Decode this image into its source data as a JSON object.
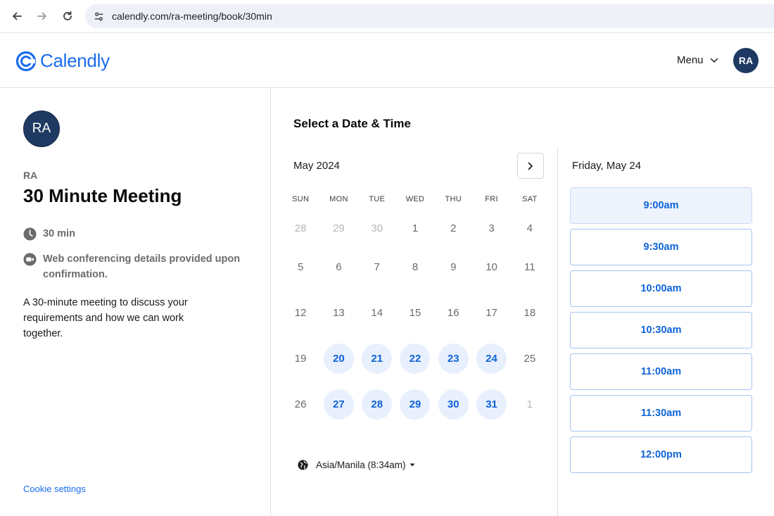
{
  "browser": {
    "url": "calendly.com/ra-meeting/book/30min",
    "icons": {
      "back": "arrow-left-icon",
      "forward": "arrow-right-icon",
      "reload": "reload-icon",
      "site_settings": "tune-icon"
    }
  },
  "header": {
    "logo_text": "Calendly",
    "menu_label": "Menu",
    "avatar_initials": "RA",
    "brand_color": "#1a6bf0",
    "avatar_color": "#1e3a62"
  },
  "event": {
    "host_initials": "RA",
    "host_name": "RA",
    "title": "30 Minute Meeting",
    "duration": "30 min",
    "conferencing_line1": "Web conferencing details provided upon",
    "conferencing_line2": "confirmation.",
    "description": "A 30-minute meeting to discuss your requirements and how we can work together.",
    "cookie_settings": "Cookie settings"
  },
  "calendar": {
    "heading": "Select a Date & Time",
    "month": "May 2024",
    "weekdays": [
      "SUN",
      "MON",
      "TUE",
      "WED",
      "THU",
      "FRI",
      "SAT"
    ],
    "weeks": [
      [
        {
          "d": "28",
          "s": "outside"
        },
        {
          "d": "29",
          "s": "outside"
        },
        {
          "d": "30",
          "s": "outside"
        },
        {
          "d": "1",
          "s": "unavailable"
        },
        {
          "d": "2",
          "s": "unavailable"
        },
        {
          "d": "3",
          "s": "unavailable"
        },
        {
          "d": "4",
          "s": "unavailable"
        }
      ],
      [
        {
          "d": "5",
          "s": "unavailable"
        },
        {
          "d": "6",
          "s": "unavailable"
        },
        {
          "d": "7",
          "s": "unavailable"
        },
        {
          "d": "8",
          "s": "unavailable"
        },
        {
          "d": "9",
          "s": "unavailable"
        },
        {
          "d": "10",
          "s": "unavailable"
        },
        {
          "d": "11",
          "s": "unavailable"
        }
      ],
      [
        {
          "d": "12",
          "s": "unavailable"
        },
        {
          "d": "13",
          "s": "unavailable"
        },
        {
          "d": "14",
          "s": "unavailable"
        },
        {
          "d": "15",
          "s": "unavailable"
        },
        {
          "d": "16",
          "s": "unavailable"
        },
        {
          "d": "17",
          "s": "unavailable"
        },
        {
          "d": "18",
          "s": "unavailable"
        }
      ],
      [
        {
          "d": "19",
          "s": "unavailable"
        },
        {
          "d": "20",
          "s": "available"
        },
        {
          "d": "21",
          "s": "available"
        },
        {
          "d": "22",
          "s": "available"
        },
        {
          "d": "23",
          "s": "available"
        },
        {
          "d": "24",
          "s": "available"
        },
        {
          "d": "25",
          "s": "unavailable"
        }
      ],
      [
        {
          "d": "26",
          "s": "unavailable"
        },
        {
          "d": "27",
          "s": "available"
        },
        {
          "d": "28",
          "s": "available"
        },
        {
          "d": "29",
          "s": "available"
        },
        {
          "d": "30",
          "s": "available"
        },
        {
          "d": "31",
          "s": "available"
        },
        {
          "d": "1",
          "s": "outside"
        }
      ]
    ],
    "timezone": "Asia/Manila (8:34am)",
    "available_color": "#0e63d8"
  },
  "times": {
    "selected_date": "Friday, May 24",
    "slots": [
      "9:00am",
      "9:30am",
      "10:00am",
      "10:30am",
      "11:00am",
      "11:30am",
      "12:00pm"
    ]
  }
}
